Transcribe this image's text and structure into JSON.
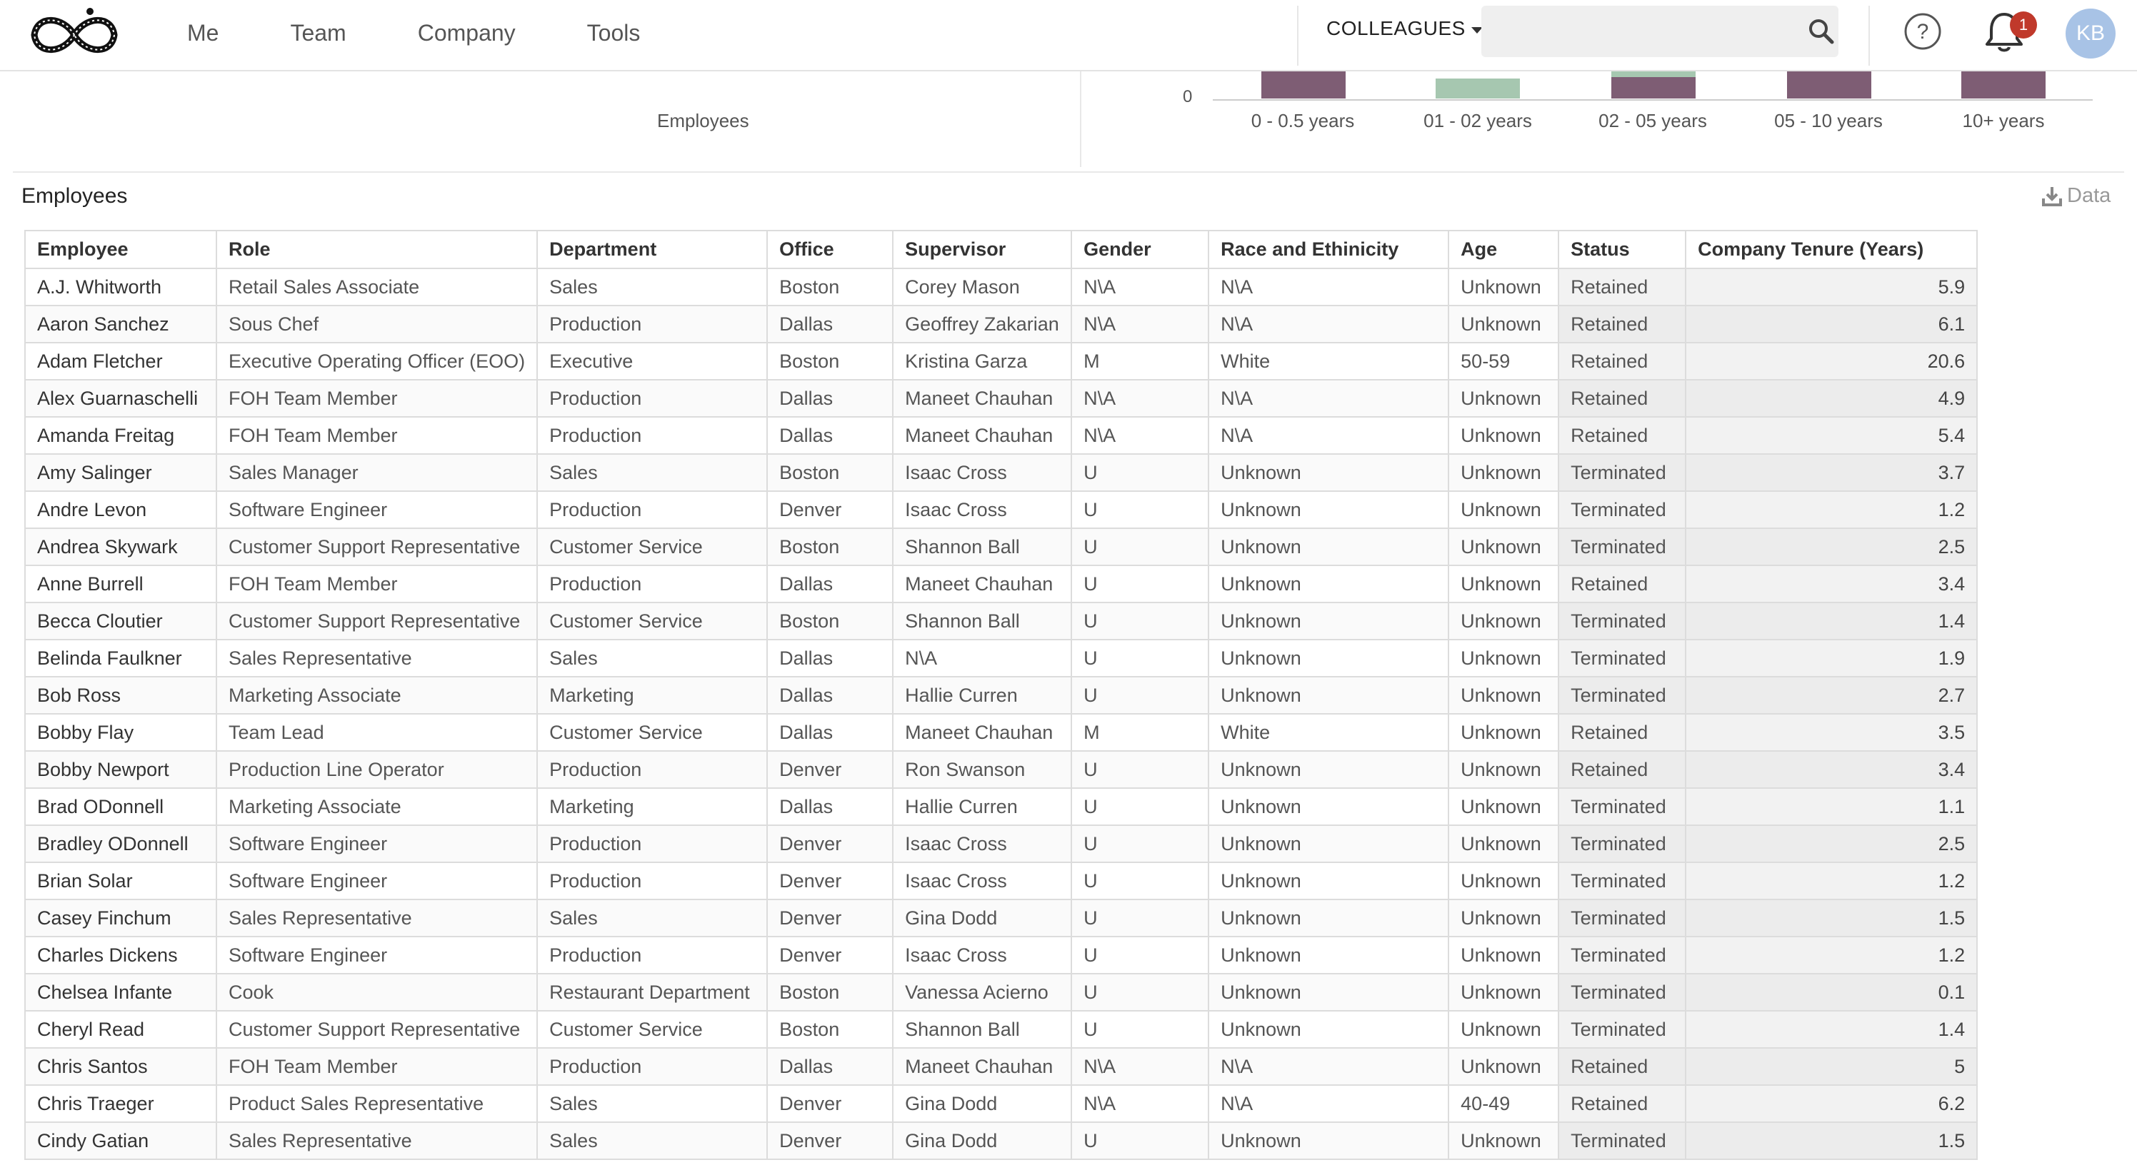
{
  "nav": {
    "links": [
      "Me",
      "Team",
      "Company",
      "Tools"
    ],
    "colleagues_label": "COLLEAGUES",
    "search_placeholder": "",
    "notifications_count": "1",
    "avatar_initials": "KB"
  },
  "chart_fragment": {
    "left_panel_label": "Employees",
    "y_zero_label": "0",
    "x_labels": [
      "0 - 0.5 years",
      "01 - 02 years",
      "02 - 05 years",
      "05 - 10 years",
      "10+ years"
    ],
    "colors": {
      "terminated": "#7e5d74",
      "retained": "#a6c7b0"
    }
  },
  "section": {
    "title": "Employees",
    "data_link": "Data"
  },
  "table": {
    "headers": [
      "Employee",
      "Role",
      "Department",
      "Office",
      "Supervisor",
      "Gender",
      "Race and Ethinicity",
      "Age",
      "Status",
      "Company Tenure (Years)"
    ],
    "rows": [
      [
        "A.J. Whitworth",
        "Retail Sales Associate",
        "Sales",
        "Boston",
        "Corey Mason",
        "N\\A",
        "N\\A",
        "Unknown",
        "Retained",
        "5.9"
      ],
      [
        "Aaron Sanchez",
        "Sous Chef",
        "Production",
        "Dallas",
        "Geoffrey Zakarian",
        "N\\A",
        "N\\A",
        "Unknown",
        "Retained",
        "6.1"
      ],
      [
        "Adam Fletcher",
        "Executive Operating Officer (EOO)",
        "Executive",
        "Boston",
        "Kristina Garza",
        "M",
        "White",
        "50-59",
        "Retained",
        "20.6"
      ],
      [
        "Alex Guarnaschelli",
        "FOH Team Member",
        "Production",
        "Dallas",
        "Maneet Chauhan",
        "N\\A",
        "N\\A",
        "Unknown",
        "Retained",
        "4.9"
      ],
      [
        "Amanda Freitag",
        "FOH Team Member",
        "Production",
        "Dallas",
        "Maneet Chauhan",
        "N\\A",
        "N\\A",
        "Unknown",
        "Retained",
        "5.4"
      ],
      [
        "Amy Salinger",
        "Sales Manager",
        "Sales",
        "Boston",
        "Isaac Cross",
        "U",
        "Unknown",
        "Unknown",
        "Terminated",
        "3.7"
      ],
      [
        "Andre Levon",
        "Software Engineer",
        "Production",
        "Denver",
        "Isaac Cross",
        "U",
        "Unknown",
        "Unknown",
        "Terminated",
        "1.2"
      ],
      [
        "Andrea Skywark",
        "Customer Support Representative",
        "Customer Service",
        "Boston",
        "Shannon Ball",
        "U",
        "Unknown",
        "Unknown",
        "Terminated",
        "2.5"
      ],
      [
        "Anne Burrell",
        "FOH Team Member",
        "Production",
        "Dallas",
        "Maneet Chauhan",
        "U",
        "Unknown",
        "Unknown",
        "Retained",
        "3.4"
      ],
      [
        "Becca Cloutier",
        "Customer Support Representative",
        "Customer Service",
        "Boston",
        "Shannon Ball",
        "U",
        "Unknown",
        "Unknown",
        "Terminated",
        "1.4"
      ],
      [
        "Belinda Faulkner",
        "Sales Representative",
        "Sales",
        "Dallas",
        "N\\A",
        "U",
        "Unknown",
        "Unknown",
        "Terminated",
        "1.9"
      ],
      [
        "Bob Ross",
        "Marketing Associate",
        "Marketing",
        "Dallas",
        "Hallie Curren",
        "U",
        "Unknown",
        "Unknown",
        "Terminated",
        "2.7"
      ],
      [
        "Bobby Flay",
        "Team Lead",
        "Customer Service",
        "Dallas",
        "Maneet Chauhan",
        "M",
        "White",
        "Unknown",
        "Retained",
        "3.5"
      ],
      [
        "Bobby Newport",
        "Production Line Operator",
        "Production",
        "Denver",
        "Ron Swanson",
        "U",
        "Unknown",
        "Unknown",
        "Retained",
        "3.4"
      ],
      [
        "Brad ODonnell",
        "Marketing Associate",
        "Marketing",
        "Dallas",
        "Hallie Curren",
        "U",
        "Unknown",
        "Unknown",
        "Terminated",
        "1.1"
      ],
      [
        "Bradley ODonnell",
        "Software Engineer",
        "Production",
        "Denver",
        "Isaac Cross",
        "U",
        "Unknown",
        "Unknown",
        "Terminated",
        "2.5"
      ],
      [
        "Brian Solar",
        "Software Engineer",
        "Production",
        "Denver",
        "Isaac Cross",
        "U",
        "Unknown",
        "Unknown",
        "Terminated",
        "1.2"
      ],
      [
        "Casey Finchum",
        "Sales Representative",
        "Sales",
        "Denver",
        "Gina Dodd",
        "U",
        "Unknown",
        "Unknown",
        "Terminated",
        "1.5"
      ],
      [
        "Charles Dickens",
        "Software Engineer",
        "Production",
        "Denver",
        "Isaac Cross",
        "U",
        "Unknown",
        "Unknown",
        "Terminated",
        "1.2"
      ],
      [
        "Chelsea Infante",
        "Cook",
        "Restaurant Department",
        "Boston",
        "Vanessa Acierno",
        "U",
        "Unknown",
        "Unknown",
        "Terminated",
        "0.1"
      ],
      [
        "Cheryl Read",
        "Customer Support Representative",
        "Customer Service",
        "Boston",
        "Shannon Ball",
        "U",
        "Unknown",
        "Unknown",
        "Terminated",
        "1.4"
      ],
      [
        "Chris Santos",
        "FOH Team Member",
        "Production",
        "Dallas",
        "Maneet Chauhan",
        "N\\A",
        "N\\A",
        "Unknown",
        "Retained",
        "5"
      ],
      [
        "Chris Traeger",
        "Product Sales Representative",
        "Sales",
        "Denver",
        "Gina Dodd",
        "N\\A",
        "N\\A",
        "40-49",
        "Retained",
        "6.2"
      ],
      [
        "Cindy Gatian",
        "Sales Representative",
        "Sales",
        "Denver",
        "Gina Dodd",
        "U",
        "Unknown",
        "Unknown",
        "Terminated",
        "1.5"
      ]
    ]
  }
}
